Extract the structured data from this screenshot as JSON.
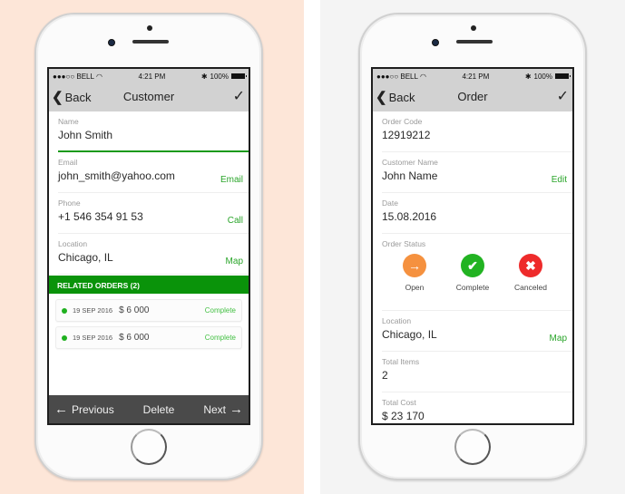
{
  "colors": {
    "left_background": "#fde6d8",
    "right_background": "#f4f4f4",
    "accent_green": "#0a930a",
    "link_green": "#2aa52a",
    "open_orange": "#f5913f",
    "complete_green": "#22b322",
    "canceled_red": "#ee2b2b"
  },
  "status_bar": {
    "carrier": "●●●○○ BELL",
    "wifi_icon": "wifi-icon",
    "time": "4:21 PM",
    "bluetooth_icon": "bluetooth-icon",
    "battery": "100%"
  },
  "customer_screen": {
    "nav": {
      "back_label": "Back",
      "title": "Customer",
      "confirm_icon": "checkmark-icon"
    },
    "fields": [
      {
        "label": "Name",
        "value": "John Smith",
        "action": ""
      },
      {
        "label": "Email",
        "value": "john_smith@yahoo.com",
        "action": "Email"
      },
      {
        "label": "Phone",
        "value": "+1 546 354 91 53",
        "action": "Call"
      },
      {
        "label": "Location",
        "value": "Chicago, IL",
        "action": "Map"
      }
    ],
    "related_orders": {
      "header": "RELATED ORDERS (2)",
      "items": [
        {
          "date": "19 SEP 2016",
          "amount": "$ 6 000",
          "status": "Complete"
        },
        {
          "date": "19 SEP 2016",
          "amount": "$ 6 000",
          "status": "Complete"
        }
      ]
    },
    "toolbar": {
      "previous_label": "Previous",
      "delete_label": "Delete",
      "next_label": "Next"
    }
  },
  "order_screen": {
    "nav": {
      "back_label": "Back",
      "title": "Order",
      "confirm_icon": "checkmark-icon"
    },
    "fields_top": [
      {
        "label": "Order Code",
        "value": "12919212",
        "action": ""
      },
      {
        "label": "Customer Name",
        "value": "John Name",
        "action": "Edit"
      },
      {
        "label": "Date",
        "value": "15.08.2016",
        "action": ""
      }
    ],
    "order_status": {
      "label": "Order Status",
      "options": [
        {
          "label": "Open",
          "icon": "arrow-right-icon"
        },
        {
          "label": "Complete",
          "icon": "check-icon"
        },
        {
          "label": "Canceled",
          "icon": "x-icon"
        }
      ]
    },
    "fields_bottom": [
      {
        "label": "Location",
        "value": "Chicago, IL",
        "action": "Map"
      },
      {
        "label": "Total Items",
        "value": "2",
        "action": ""
      },
      {
        "label": "Total Cost",
        "value": "$ 23 170",
        "action": ""
      }
    ]
  }
}
